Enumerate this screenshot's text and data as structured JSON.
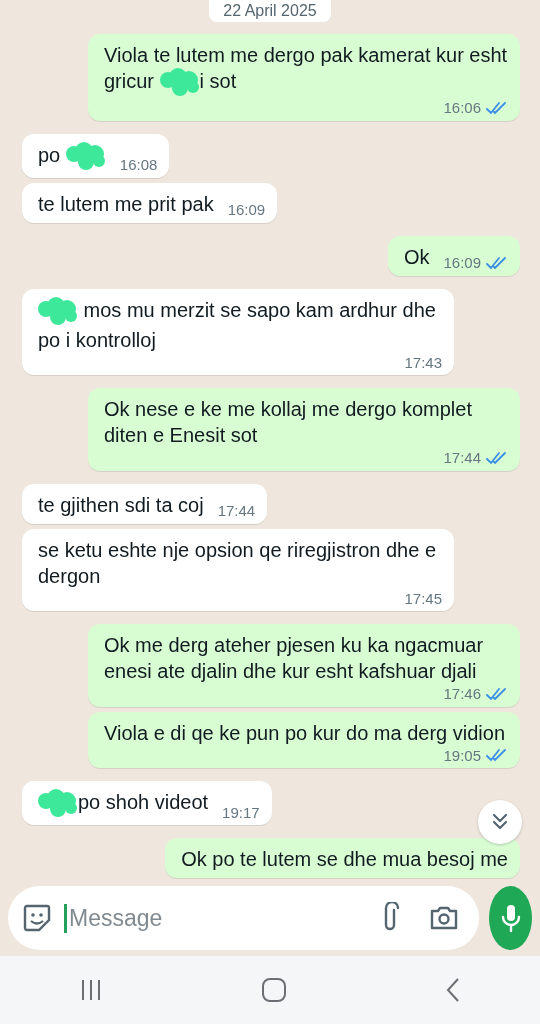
{
  "date_chip": "22 April 2025",
  "messages": [
    {
      "kind": "out",
      "parts": [
        {
          "kind": "text",
          "text": "Viola te lutem me dergo pak kamerat kur esht gricur "
        },
        {
          "kind": "redaction"
        },
        {
          "kind": "text",
          "text": "i sot"
        }
      ],
      "time": "16:06",
      "read": true
    },
    {
      "kind": "in",
      "parts": [
        {
          "kind": "text",
          "text": "po "
        },
        {
          "kind": "redaction"
        }
      ],
      "time": "16:08"
    },
    {
      "kind": "in",
      "parts": [
        {
          "kind": "text",
          "text": "te lutem me prit pak"
        }
      ],
      "time": "16:09"
    },
    {
      "kind": "out",
      "parts": [
        {
          "kind": "text",
          "text": "Ok"
        }
      ],
      "time": "16:09",
      "read": true
    },
    {
      "kind": "in",
      "parts": [
        {
          "kind": "redaction"
        },
        {
          "kind": "text",
          "text": " mos mu merzit se sapo kam ardhur dhe po i kontrolloj"
        }
      ],
      "time": "17:43"
    },
    {
      "kind": "out",
      "parts": [
        {
          "kind": "text",
          "text": "Ok nese e ke me kollaj me dergo komplet diten e Enesit sot"
        }
      ],
      "time": "17:44",
      "read": true
    },
    {
      "kind": "in",
      "parts": [
        {
          "kind": "text",
          "text": "te gjithen sdi ta coj"
        }
      ],
      "time": "17:44"
    },
    {
      "kind": "in",
      "parts": [
        {
          "kind": "text",
          "text": "se ketu eshte nje opsion qe riregjistron dhe e dergon"
        }
      ],
      "time": "17:45"
    },
    {
      "kind": "out",
      "parts": [
        {
          "kind": "text",
          "text": "Ok me derg ateher pjesen ku ka ngacmuar enesi ate djalin dhe kur esht kafshuar djali"
        }
      ],
      "time": "17:46",
      "read": true
    },
    {
      "kind": "out",
      "parts": [
        {
          "kind": "text",
          "text": "Viola e di qe ke pun po kur do ma derg vidion"
        }
      ],
      "time": "19:05",
      "read": true
    },
    {
      "kind": "in",
      "parts": [
        {
          "kind": "redaction"
        },
        {
          "kind": "text",
          "text": "po shoh videot"
        }
      ],
      "time": "19:17"
    },
    {
      "kind": "out",
      "parts": [
        {
          "kind": "text",
          "text": "Ok po te lutem se dhe mua besoj me"
        }
      ]
    }
  ],
  "composer": {
    "placeholder": "Message"
  }
}
